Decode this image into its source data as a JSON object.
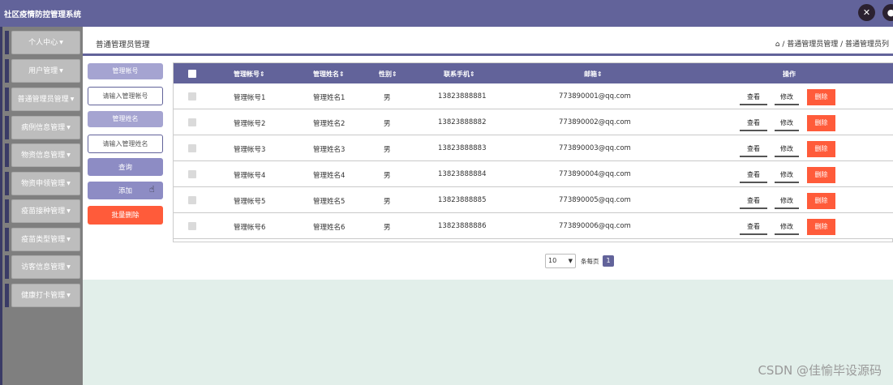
{
  "app": {
    "title": "社区疫情防控管理系统"
  },
  "top_icons": [
    {
      "name": "fullscreen-icon",
      "glyph": "✕"
    },
    {
      "name": "user-icon",
      "glyph": "●"
    }
  ],
  "sidebar": {
    "items": [
      {
        "label": "个人中心"
      },
      {
        "label": "用户管理"
      },
      {
        "label": "普通管理员管理"
      },
      {
        "label": "病例信息管理"
      },
      {
        "label": "物资信息管理"
      },
      {
        "label": "物资申领管理"
      },
      {
        "label": "疫苗接种管理"
      },
      {
        "label": "疫苗类型管理"
      },
      {
        "label": "访客信息管理"
      },
      {
        "label": "健康打卡管理"
      }
    ]
  },
  "header": {
    "page_title": "普通管理员管理",
    "breadcrumb": "⌂ / 普通管理员管理 / 普通管理员列"
  },
  "filters": {
    "account_label": "管理帐号",
    "account_placeholder": "请输入管理帐号",
    "name_label": "管理姓名",
    "name_placeholder": "请输入管理姓名",
    "search_label": "查询",
    "add_label": "添加",
    "batch_delete_label": "批量删除"
  },
  "table": {
    "headers": {
      "account": "管理帐号⇕",
      "name": "管理姓名⇕",
      "gender": "性别⇕",
      "phone": "联系手机⇕",
      "email": "邮箱⇕",
      "actions": "操作"
    },
    "view_label": "查看",
    "edit_label": "修改",
    "delete_label": "删除",
    "rows": [
      {
        "account": "管理帐号1",
        "name": "管理姓名1",
        "gender": "男",
        "phone": "13823888881",
        "email": "773890001@qq.com"
      },
      {
        "account": "管理帐号2",
        "name": "管理姓名2",
        "gender": "男",
        "phone": "13823888882",
        "email": "773890002@qq.com"
      },
      {
        "account": "管理帐号3",
        "name": "管理姓名3",
        "gender": "男",
        "phone": "13823888883",
        "email": "773890003@qq.com"
      },
      {
        "account": "管理帐号4",
        "name": "管理姓名4",
        "gender": "男",
        "phone": "13823888884",
        "email": "773890004@qq.com"
      },
      {
        "account": "管理帐号5",
        "name": "管理姓名5",
        "gender": "男",
        "phone": "13823888885",
        "email": "773890005@qq.com"
      },
      {
        "account": "管理帐号6",
        "name": "管理姓名6",
        "gender": "男",
        "phone": "13823888886",
        "email": "773890006@qq.com"
      }
    ]
  },
  "pagination": {
    "page_size": "10",
    "page_size_text": "条每页",
    "current_page": "1"
  },
  "watermark": "CSDN @佳愉毕设源码",
  "colors": {
    "accent": "#62639a",
    "danger": "#ff5b3a",
    "sidebar": "#7f7f7f"
  }
}
